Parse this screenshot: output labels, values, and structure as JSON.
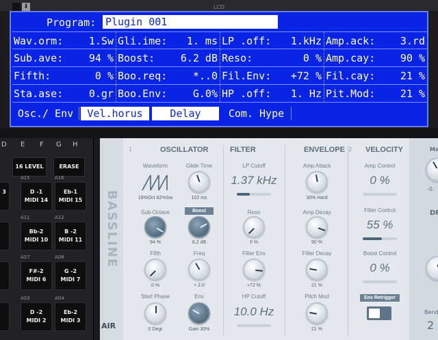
{
  "top_bar": {
    "lcd_label": "LCD"
  },
  "lcd": {
    "program_label": "Program:",
    "program_value": "Plugin 001",
    "rows": [
      [
        {
          "label": "Wav.orm:",
          "value": "1.Sw"
        },
        {
          "label": "Gli.ime:",
          "value": "1. ms"
        },
        {
          "label": "LP .off:",
          "value": "1.kHz"
        },
        {
          "label": "Amp.ack:",
          "value": "3.rd"
        }
      ],
      [
        {
          "label": "Sub.ave:",
          "value": "94 %"
        },
        {
          "label": "Boost:",
          "value": "6.2 dB"
        },
        {
          "label": "Reso:",
          "value": "0 %"
        },
        {
          "label": "Amp.cay:",
          "value": "90 %"
        }
      ],
      [
        {
          "label": "Fifth:",
          "value": "0 %"
        },
        {
          "label": "Boo.req:",
          "value": "*..0"
        },
        {
          "label": "Fil.Env:",
          "value": "+72 %"
        },
        {
          "label": "Fil.cay:",
          "value": "21 %"
        }
      ],
      [
        {
          "label": "Sta.ase:",
          "value": "0.gr"
        },
        {
          "label": "Boo.Env:",
          "value": "G.0%"
        },
        {
          "label": "HP .off:",
          "value": "1. Hz"
        },
        {
          "label": "Pit.Mod:",
          "value": "21 %"
        }
      ]
    ],
    "tabs": [
      {
        "label": "Osc./ Env",
        "selected": false
      },
      {
        "label": "Vel.horus",
        "selected": true
      },
      {
        "label": "Delay",
        "selected": true
      },
      {
        "label": "Com. Hype",
        "selected": false
      }
    ]
  },
  "pads": {
    "columns": [
      "D",
      "E",
      "F",
      "G",
      "H"
    ],
    "buttons": {
      "sixteen_level": "16 LEVEL",
      "erase": "ERASE"
    },
    "grid": [
      [
        {
          "num": "",
          "n1": "3",
          "n2": "",
          "cut": true
        },
        {
          "num": "A15",
          "n1": "D -1",
          "n2": "MIDI 14"
        },
        {
          "num": "A16",
          "n1": "Eb-1",
          "n2": "MIDI 15"
        }
      ],
      [
        {
          "num": "",
          "n1": "",
          "n2": "",
          "cut": true
        },
        {
          "num": "A11",
          "n1": "Bb-2",
          "n2": "MIDI 10"
        },
        {
          "num": "A12",
          "n1": "B -2",
          "n2": "MIDI 11"
        }
      ],
      [
        {
          "num": "",
          "n1": "",
          "n2": "",
          "cut": true
        },
        {
          "num": "A07",
          "n1": "F#-2",
          "n2": "MIDI 6"
        },
        {
          "num": "A08",
          "n1": "G -2",
          "n2": "MIDI 7"
        }
      ],
      [
        {
          "num": "",
          "n1": "",
          "n2": "",
          "cut": true
        },
        {
          "num": "A03",
          "n1": "D -2",
          "n2": "MIDI 2"
        },
        {
          "num": "A04",
          "n1": "Eb-2",
          "n2": "MIDI 3"
        }
      ]
    ]
  },
  "plugin": {
    "brand": "BASSLINE",
    "logo": "AIR",
    "sections": {
      "oscillator": "OSCILLATOR",
      "filter": "FILTER",
      "envelope": "ENVELOPE",
      "velocity": "VELOCITY",
      "num1": "1",
      "num2": "2"
    },
    "osc": {
      "waveform": {
        "label": "Waveform",
        "value": "18%Oct 82%Sw"
      },
      "glide": {
        "label": "Glide Time",
        "value": "102 ms"
      },
      "sub": {
        "label": "Sub-Octave",
        "value": "94 %"
      },
      "boost_badge": "Boost",
      "boost": {
        "value": "6.2 dB"
      },
      "fifth": {
        "label": "Fifth",
        "value": "0 %"
      },
      "freq": {
        "label": "Freq",
        "value": "+ 2.0"
      },
      "start_phase": {
        "label": "Start Phase",
        "value": "0 Degr"
      },
      "env": {
        "label": "Env",
        "value": "Gain 30%"
      }
    },
    "filter": {
      "lp_cutoff": {
        "label": "LP Cutoff",
        "value": "1.37 kHz"
      },
      "reso": {
        "label": "Reso",
        "value": "0 %"
      },
      "filter_env": {
        "label": "Filter Env",
        "value": "+72 %"
      },
      "hp_cutoff": {
        "label": "HP Cutoff",
        "value": "10.0 Hz"
      }
    },
    "envelope": {
      "amp_attack": {
        "label": "Amp Attack",
        "value": "30% Hard"
      },
      "amp_decay": {
        "label": "Amp Decay",
        "value": "90 %"
      },
      "filter_decay": {
        "label": "Filter Decay",
        "value": "21 %"
      },
      "pitch_mod": {
        "label": "Pitch Mod",
        "value": "21 %"
      }
    },
    "velocity": {
      "amp_control": {
        "label": "Amp Control",
        "value": "0 %"
      },
      "filter_control": {
        "label": "Filter Control",
        "value": "55 %"
      },
      "boost_control": {
        "label": "Boost Control",
        "value": "0 %"
      },
      "env_retrigger": "Env Retrigger"
    },
    "right_edge": {
      "ma": "Ma",
      "dr": "DR",
      "bend_label": "Bend",
      "bend_value": "2",
      "neg": "-0."
    }
  }
}
